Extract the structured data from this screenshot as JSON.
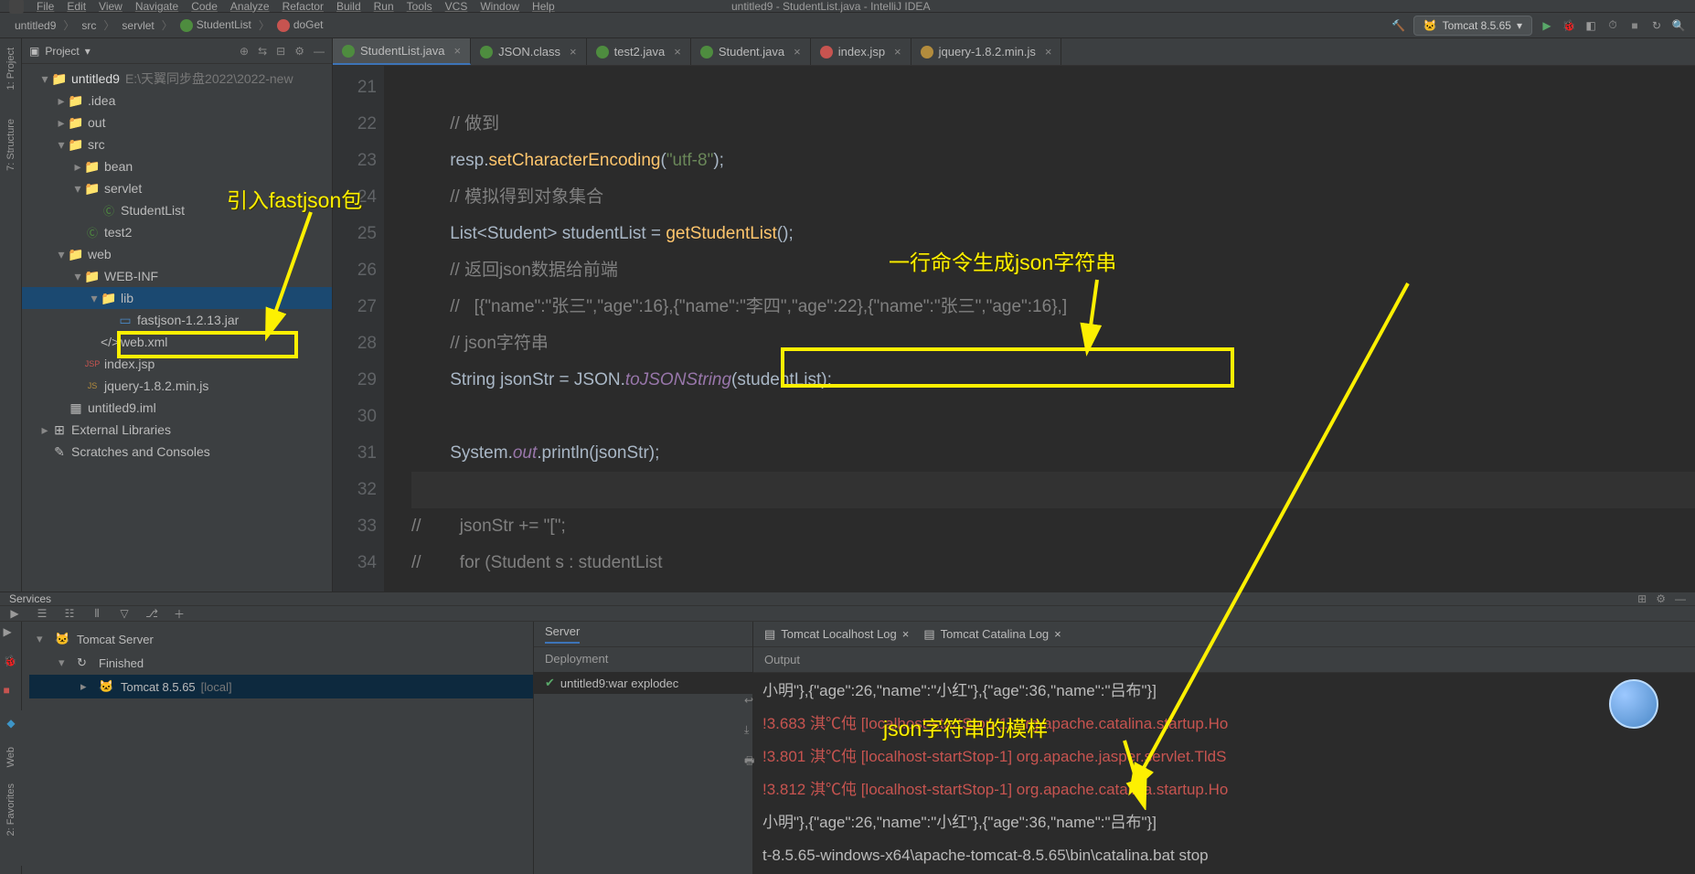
{
  "window": {
    "title": "untitled9 - StudentList.java - IntelliJ IDEA"
  },
  "menu": {
    "items": [
      "File",
      "Edit",
      "View",
      "Navigate",
      "Code",
      "Analyze",
      "Refactor",
      "Build",
      "Run",
      "Tools",
      "VCS",
      "Window",
      "Help"
    ]
  },
  "breadcrumb": {
    "items": [
      "untitled9",
      "src",
      "servlet",
      "StudentList",
      "doGet"
    ]
  },
  "run": {
    "config_label": "Tomcat 8.5.65"
  },
  "project_panel": {
    "title": "Project"
  },
  "editor_tabs": [
    {
      "label": "StudentList.java",
      "active": true,
      "icon": "class"
    },
    {
      "label": "JSON.class",
      "active": false,
      "icon": "class"
    },
    {
      "label": "test2.java",
      "active": false,
      "icon": "class"
    },
    {
      "label": "Student.java",
      "active": false,
      "icon": "class"
    },
    {
      "label": "index.jsp",
      "active": false,
      "icon": "jsp"
    },
    {
      "label": "jquery-1.8.2.min.js",
      "active": false,
      "icon": "js"
    }
  ],
  "project_tree": [
    {
      "depth": 0,
      "arrow": "▾",
      "icon": "folder-blue",
      "label": "untitled9",
      "suffix": " E:\\天翼同步盘2022\\2022-new",
      "bold": true
    },
    {
      "depth": 1,
      "arrow": "▸",
      "icon": "folder",
      "label": ".idea"
    },
    {
      "depth": 1,
      "arrow": "▸",
      "icon": "folder-orange",
      "label": "out"
    },
    {
      "depth": 1,
      "arrow": "▾",
      "icon": "folder-blue",
      "label": "src"
    },
    {
      "depth": 2,
      "arrow": "▸",
      "icon": "folder",
      "label": "bean"
    },
    {
      "depth": 2,
      "arrow": "▾",
      "icon": "folder",
      "label": "servlet"
    },
    {
      "depth": 3,
      "arrow": "",
      "icon": "class",
      "label": "StudentList"
    },
    {
      "depth": 2,
      "arrow": "",
      "icon": "class",
      "label": "test2"
    },
    {
      "depth": 1,
      "arrow": "▾",
      "icon": "folder-blue",
      "label": "web"
    },
    {
      "depth": 2,
      "arrow": "▾",
      "icon": "folder",
      "label": "WEB-INF"
    },
    {
      "depth": 3,
      "arrow": "▾",
      "icon": "folder",
      "label": "lib",
      "selected": true
    },
    {
      "depth": 4,
      "arrow": "",
      "icon": "jar",
      "label": "fastjson-1.2.13.jar",
      "boxed": true
    },
    {
      "depth": 3,
      "arrow": "",
      "icon": "xml",
      "label": "web.xml"
    },
    {
      "depth": 2,
      "arrow": "",
      "icon": "jsp",
      "label": "index.jsp"
    },
    {
      "depth": 2,
      "arrow": "",
      "icon": "js",
      "label": "jquery-1.8.2.min.js"
    },
    {
      "depth": 1,
      "arrow": "",
      "icon": "file",
      "label": "untitled9.iml"
    },
    {
      "depth": 0,
      "arrow": "▸",
      "icon": "lib",
      "label": "External Libraries"
    },
    {
      "depth": 0,
      "arrow": "",
      "icon": "scratch",
      "label": "Scratches and Consoles"
    }
  ],
  "gutter_lines": [
    "21",
    "22",
    "23",
    "24",
    "25",
    "26",
    "27",
    "28",
    "29",
    "30",
    "31",
    "32",
    "33",
    "34"
  ],
  "code_lines": [
    {
      "n": 21,
      "html": ""
    },
    {
      "n": 22,
      "html": "        <span class='cmt'>// 做到</span>"
    },
    {
      "n": 23,
      "html": "        resp.<span class='fn'>setCharacterEncoding</span>(<span class='str'>\"utf-8\"</span>);"
    },
    {
      "n": 24,
      "html": "        <span class='cmt'>// 模拟得到对象集合</span>"
    },
    {
      "n": 25,
      "html": "        List&lt;Student&gt; studentList = <span class='fn'>getStudentList</span>();"
    },
    {
      "n": 26,
      "html": "        <span class='cmt'>// 返回json数据给前端</span>"
    },
    {
      "n": 27,
      "html": "        <span class='cmt'>//   [{\"name\":\"张三\",\"age\":16},{\"name\":\"李四\",\"age\":22},{\"name\":\"张三\",\"age\":16},]</span>"
    },
    {
      "n": 28,
      "html": "        <span class='cmt'>// json字符串</span>"
    },
    {
      "n": 29,
      "html": "        String jsonStr = JSON.<span class='it'>toJSONString</span>(studentList);"
    },
    {
      "n": 30,
      "html": ""
    },
    {
      "n": 31,
      "html": "        System.<span class='field'>out</span>.println(jsonStr);"
    },
    {
      "n": 32,
      "html": "",
      "caret": true
    },
    {
      "n": 33,
      "html": "<span class='cmt'>//        jsonStr += \"[\";</span>"
    },
    {
      "n": 34,
      "html": "<span class='cmt'>//        for (Student s : studentList</span>"
    }
  ],
  "services": {
    "title": "Services",
    "tabs": {
      "server": "Server",
      "tomcat_log": "Tomcat Localhost Log",
      "catalina_log": "Tomcat Catalina Log"
    },
    "deployment_label": "Deployment",
    "output_label": "Output",
    "deploy_item": "untitled9:war explodec",
    "tree": [
      {
        "depth": 0,
        "arrow": "▾",
        "icon": "tomcat",
        "label": "Tomcat Server"
      },
      {
        "depth": 1,
        "arrow": "▾",
        "icon": "refresh",
        "label": "Finished"
      },
      {
        "depth": 2,
        "arrow": "▸",
        "icon": "tomcat",
        "label": "Tomcat 8.5.65",
        "suffix": "[local]",
        "sel": true
      }
    ]
  },
  "console_lines": [
    {
      "cls": "sys",
      "text": "小明\"},{\"age\":26,\"name\":\"小红\"},{\"age\":36,\"name\":\"吕布\"}]"
    },
    {
      "cls": "err",
      "text": "!3.683 淇℃伅 [localhost-startStop-1] org.apache.catalina.startup.Ho"
    },
    {
      "cls": "err",
      "text": "!3.801 淇℃伅 [localhost-startStop-1] org.apache.jasper.servlet.TldS"
    },
    {
      "cls": "err",
      "text": "!3.812 淇℃伅 [localhost-startStop-1] org.apache.catalina.startup.Ho"
    },
    {
      "cls": "sys",
      "text": "小明\"},{\"age\":26,\"name\":\"小红\"},{\"age\":36,\"name\":\"吕布\"}]"
    },
    {
      "cls": "warn",
      "text": "t-8.5.65-windows-x64\\apache-tomcat-8.5.65\\bin\\catalina.bat stop"
    }
  ],
  "annotations": {
    "a1": "引入fastjson包",
    "a2": "一行命令生成json字符串",
    "a3": "json字符串的模样"
  }
}
